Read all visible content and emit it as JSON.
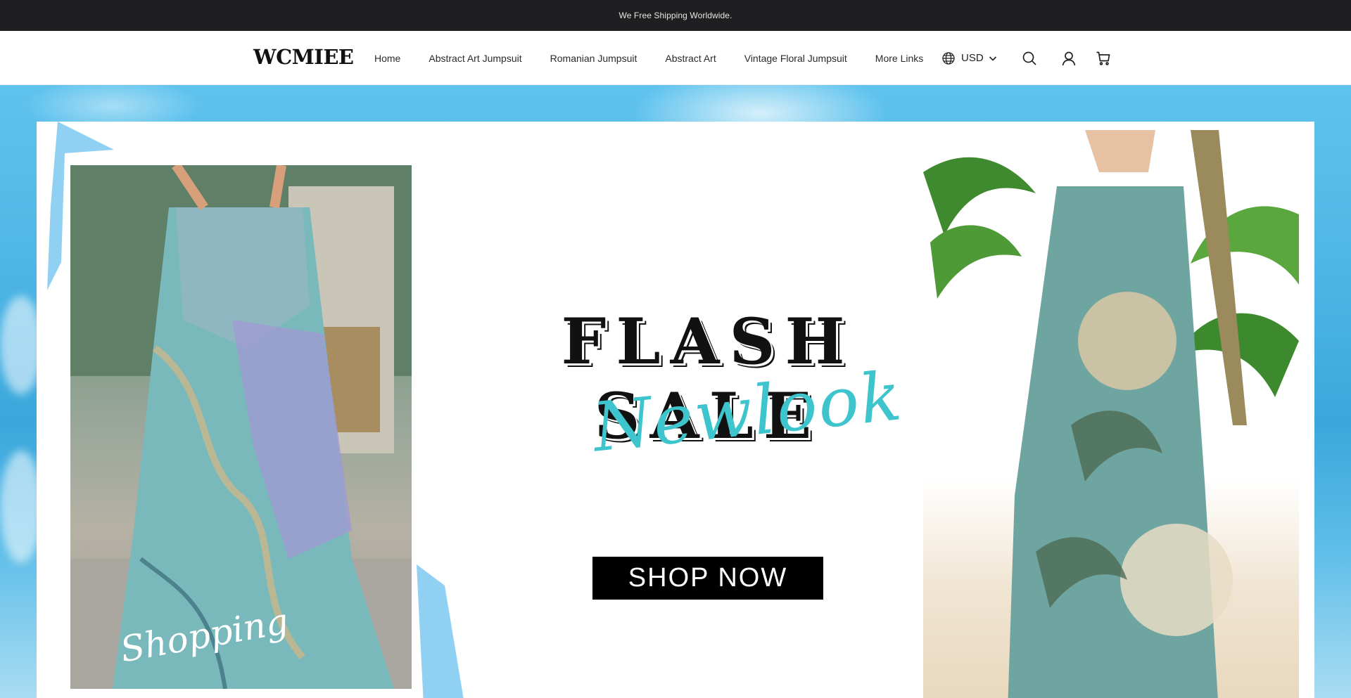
{
  "announcement": {
    "text": "We Free Shipping Worldwide."
  },
  "header": {
    "logo": "WCMIEE",
    "nav": [
      {
        "label": "Home"
      },
      {
        "label": "Abstract Art Jumpsuit"
      },
      {
        "label": "Romanian Jumpsuit"
      },
      {
        "label": "Abstract Art"
      },
      {
        "label": "Vintage Floral Jumpsuit"
      },
      {
        "label": "More Links"
      }
    ],
    "currency": {
      "label": "USD",
      "icon": "globe-icon"
    },
    "icons": {
      "search": "search-icon",
      "account": "account-icon",
      "cart": "cart-icon"
    }
  },
  "hero": {
    "title": "FLASH SALE",
    "subtitle": "Newlook",
    "button": "SHOP NOW",
    "left_image_tag": "Shopping",
    "colors": {
      "accent": "#3ec4cc",
      "button_bg": "#000000",
      "sky": "#4eb6e6"
    }
  }
}
